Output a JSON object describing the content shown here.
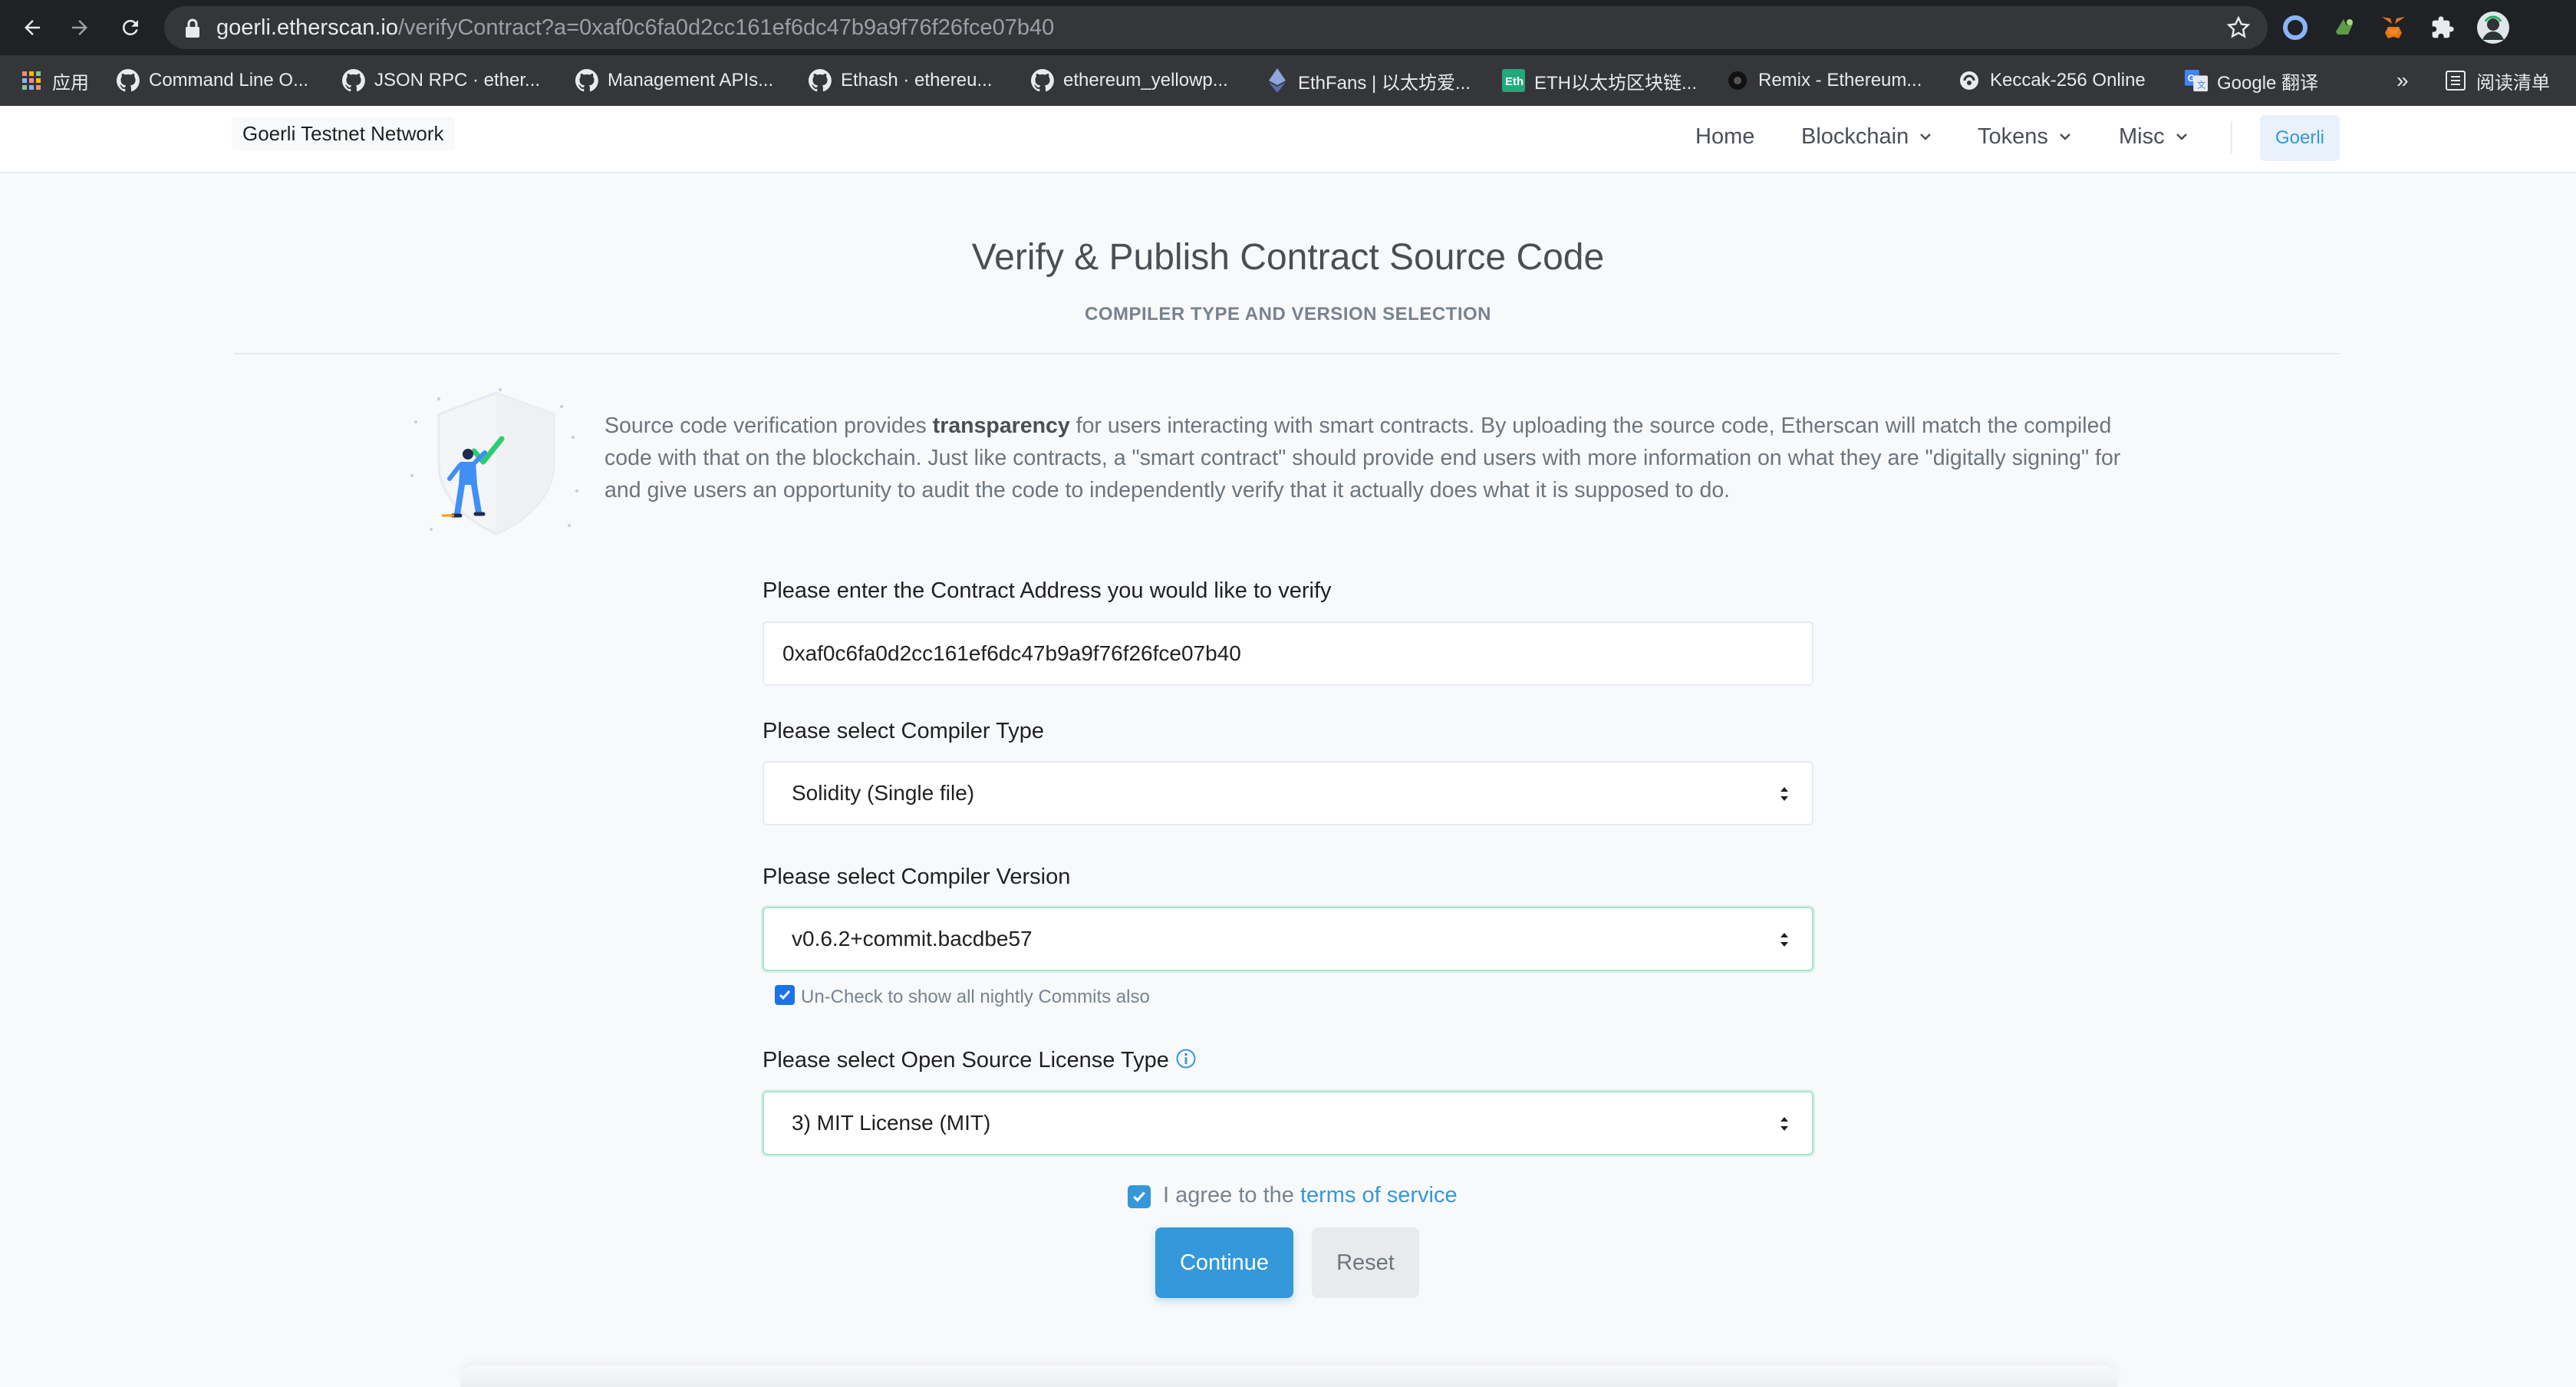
{
  "browser": {
    "url_host": "goerli.etherscan.io",
    "url_path": "/verifyContract?a=0xaf0c6fa0d2cc161ef6dc47b9a9f76f26fce07b40",
    "bookmarks": [
      {
        "label": "应用",
        "icon": "apps-grid-icon"
      },
      {
        "label": "Command Line O...",
        "icon": "github-icon"
      },
      {
        "label": "JSON RPC · ether...",
        "icon": "github-icon"
      },
      {
        "label": "Management APIs...",
        "icon": "github-icon"
      },
      {
        "label": "Ethash · ethereu...",
        "icon": "github-icon"
      },
      {
        "label": "ethereum_yellowp...",
        "icon": "github-icon"
      },
      {
        "label": "EthFans | 以太坊爱...",
        "icon": "ethereum-icon"
      },
      {
        "label": "ETH以太坊区块链...",
        "icon": "eth-site-icon"
      },
      {
        "label": "Remix - Ethereum...",
        "icon": "remix-icon"
      },
      {
        "label": "Keccak-256 Online",
        "icon": "keccak-icon"
      },
      {
        "label": "Google 翻译",
        "icon": "google-translate-icon"
      }
    ],
    "more_label": "»",
    "reading_list_label": "阅读清单"
  },
  "header": {
    "network": "Goerli Testnet Network",
    "menu": [
      {
        "label": "Home"
      },
      {
        "label": "Blockchain"
      },
      {
        "label": "Tokens"
      },
      {
        "label": "Misc"
      }
    ],
    "network_button": "Goerli"
  },
  "main": {
    "title": "Verify & Publish Contract Source Code",
    "subtitle": "COMPILER TYPE AND VERSION SELECTION",
    "intro": {
      "before": "Source code verification provides ",
      "bold": "transparency",
      "after": " for users interacting with smart contracts. By uploading the source code, Etherscan will match the compiled code with that on the blockchain. Just like contracts, a \"smart contract\" should provide end users with more information on what they are \"digitally signing\" for and give users an opportunity to audit the code to independently verify that it actually does what it is supposed to do."
    },
    "address": {
      "label": "Please enter the Contract Address you would like to verify",
      "value": "0xaf0c6fa0d2cc161ef6dc47b9a9f76f26fce07b40"
    },
    "compiler_type": {
      "label": "Please select Compiler Type",
      "value": "Solidity (Single file)"
    },
    "compiler_version": {
      "label": "Please select Compiler Version",
      "value": "v0.6.2+commit.bacdbe57",
      "nightly_checkbox_label": "Un-Check to show all nightly Commits also",
      "nightly_checked": true
    },
    "license": {
      "label": "Please select Open Source License Type",
      "value": "3) MIT License (MIT)"
    },
    "agree": {
      "text": "I agree to the ",
      "link": "terms of service",
      "checked": true
    },
    "buttons": {
      "continue": "Continue",
      "reset": "Reset"
    }
  },
  "colors": {
    "primary": "#3498db",
    "focus_border": "#a8e6c8",
    "checkbox": "#1a73e8"
  }
}
